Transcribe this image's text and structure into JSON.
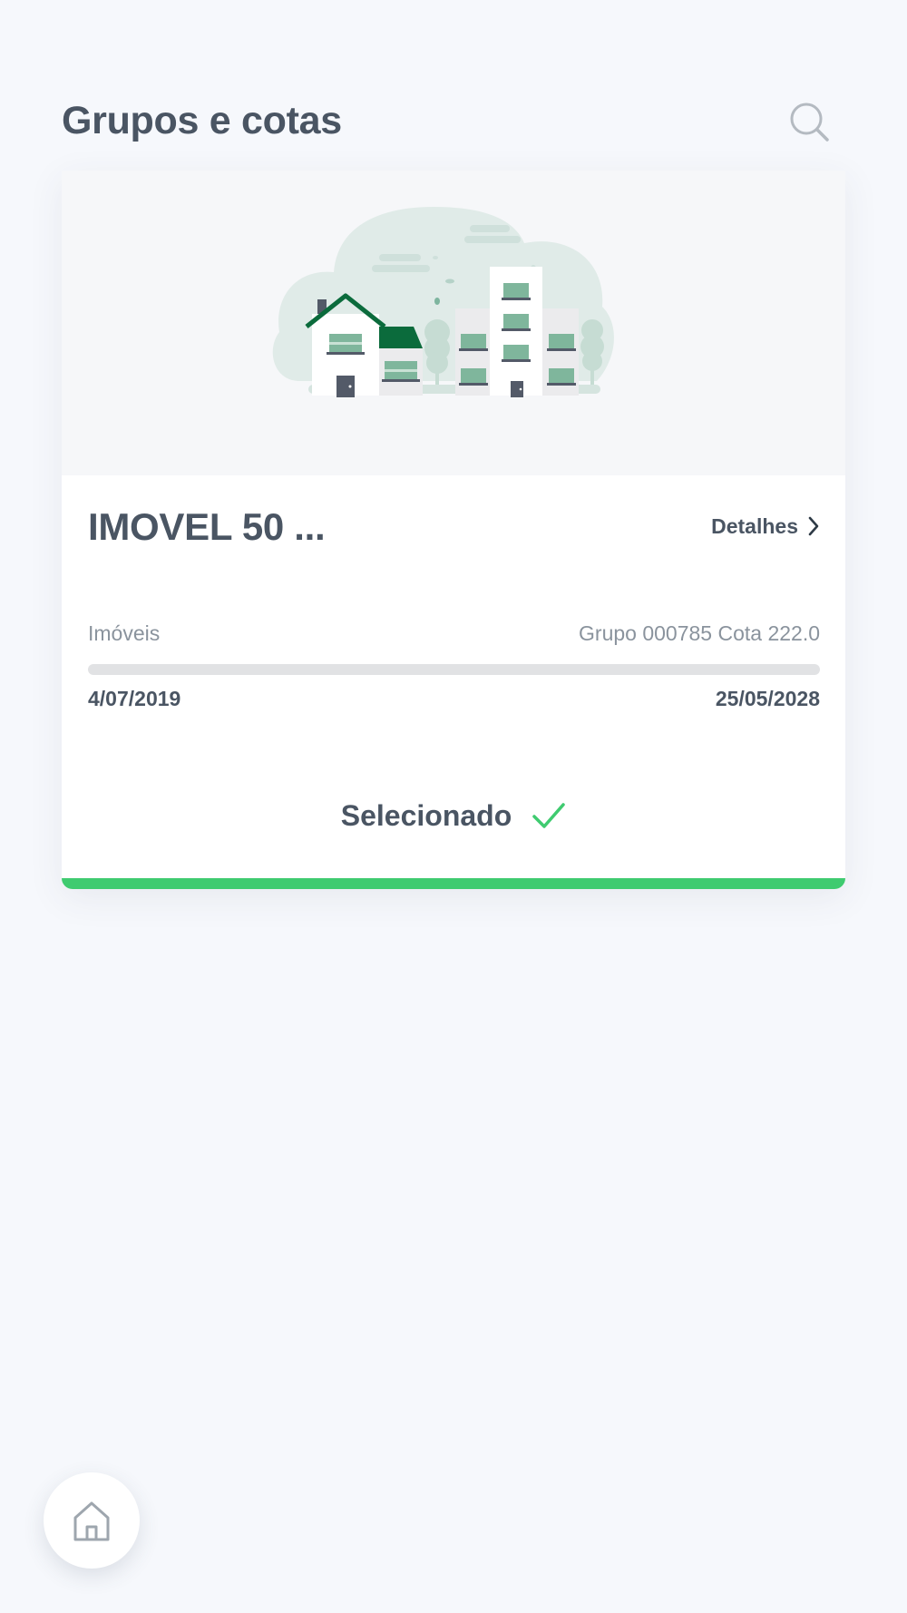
{
  "header": {
    "title": "Grupos e cotas",
    "search_icon": "search-icon"
  },
  "card": {
    "illustration": "houses-and-buildings-illustration",
    "product_name": "IMOVEL 50 ...",
    "details_label": "Detalhes",
    "category": "Imóveis",
    "group_quota": "Grupo 000785 Cota 222.0",
    "start_date": "4/07/2019",
    "end_date": "25/05/2028",
    "progress_fraction": 0,
    "selected_label": "Selecionado"
  },
  "nav": {
    "home_icon": "home-icon"
  },
  "colors": {
    "background": "#f6f8fc",
    "text": "#4a5563",
    "muted_text": "#8a939d",
    "accent_green": "#3fcb70",
    "brand_dark_green": "#0b6b3c"
  }
}
